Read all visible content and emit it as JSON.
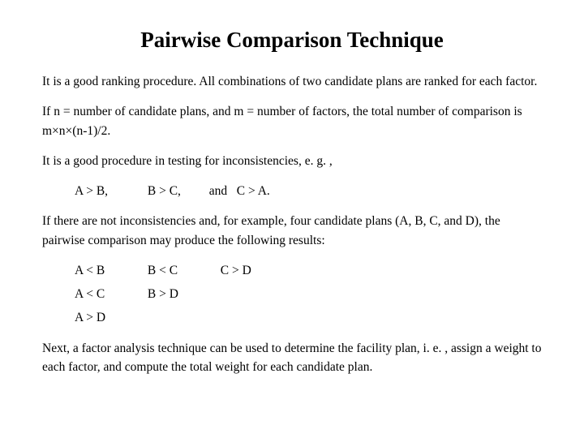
{
  "title": "Pairwise Comparison Technique",
  "p1": "It is a good ranking procedure. All combinations of two candidate plans are ranked for each factor.",
  "p2": "If n = number of candidate plans, and m = number of factors, the total number of comparison is m×n×(n-1)/2.",
  "p3": "It is a good procedure in testing for inconsistencies, e. g. ,",
  "ex1": {
    "a": "A > B,",
    "b": "B > C,",
    "c": "and",
    "d": "C > A."
  },
  "p4": "If there are not inconsistencies and, for example, four candidate plans (A, B, C, and D), the pairwise comparison may produce the following results:",
  "row1": {
    "a": "A < B",
    "b": "B < C",
    "c": "C > D"
  },
  "row2": {
    "a": "A < C",
    "b": "B > D"
  },
  "row3": {
    "a": "A > D"
  },
  "p5": "Next, a factor analysis technique can be used to determine the facility plan, i. e. , assign a weight to each factor, and compute the total weight for each candidate plan."
}
